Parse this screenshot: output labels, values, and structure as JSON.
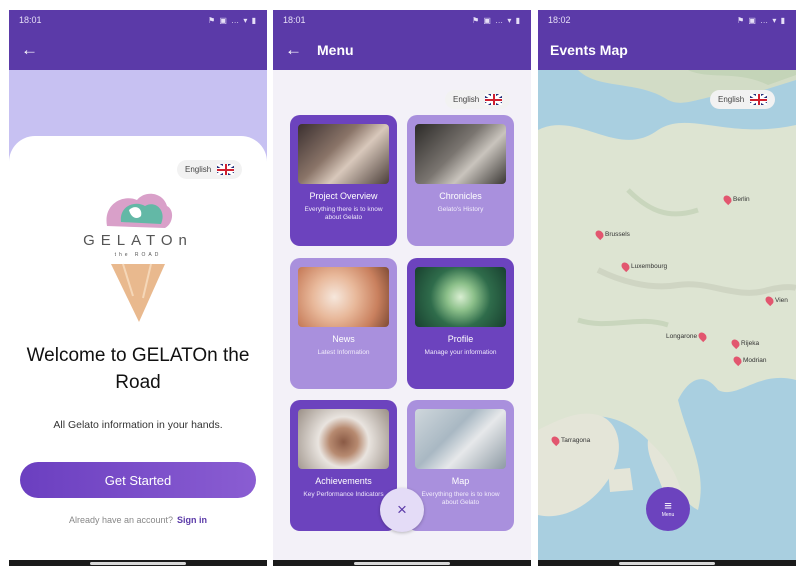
{
  "status": {
    "time_1": "18:01",
    "time_2": "18:01",
    "time_3": "18:02",
    "icons": "⚑ ▣ … ▾ ▮"
  },
  "screen1": {
    "language": "English",
    "logo_text": "GELATOn",
    "logo_sub": "the ROAD",
    "welcome": "Welcome to GELATOn the Road",
    "tagline": "All Gelato information in your hands.",
    "cta": "Get Started",
    "account_prompt": "Already have an account?",
    "sign_in": "Sign in"
  },
  "screen2": {
    "title": "Menu",
    "language": "English",
    "tiles": [
      {
        "title": "Project Overview",
        "desc": "Everything there is to know about Gelato"
      },
      {
        "title": "Chronicles",
        "desc": "Gelato's History"
      },
      {
        "title": "News",
        "desc": "Latest Information"
      },
      {
        "title": "Profile",
        "desc": "Manage your information"
      },
      {
        "title": "Achievements",
        "desc": "Key Performance Indicators"
      },
      {
        "title": "Map",
        "desc": "Everything there is to know about Gelato"
      }
    ],
    "close_glyph": "×"
  },
  "screen3": {
    "title": "Events Map",
    "language": "English",
    "pins": [
      "Berlin",
      "Brussels",
      "Luxembourg",
      "Vien",
      "Longarone",
      "Rijeka",
      "Modrian",
      "Tarragona"
    ],
    "menu_label": "Menu"
  },
  "icons": {
    "back": "←",
    "menu": "≡"
  },
  "colors": {
    "primary": "#5b3aa8",
    "tile_dark": "#6c43be",
    "tile_light": "#a990dd",
    "hero_bg": "#c7c1f2"
  }
}
